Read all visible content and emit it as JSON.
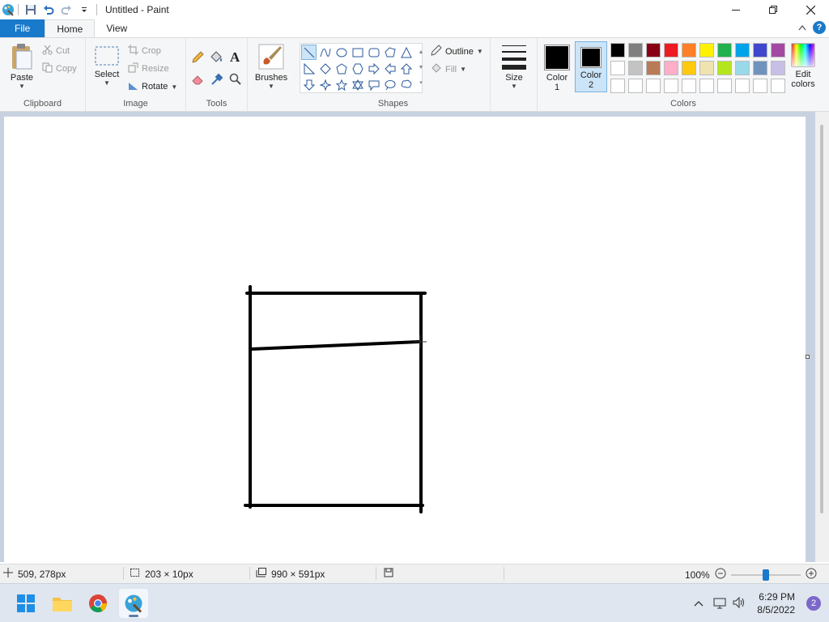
{
  "window": {
    "title": "Untitled - Paint",
    "controls": {
      "minimize": "–",
      "maximize": "❐",
      "close": "✕"
    }
  },
  "tabs": {
    "file": "File",
    "home": "Home",
    "view": "View"
  },
  "ribbon": {
    "clipboard": {
      "label": "Clipboard",
      "paste": "Paste",
      "cut": "Cut",
      "copy": "Copy"
    },
    "image": {
      "label": "Image",
      "select": "Select",
      "crop": "Crop",
      "resize": "Resize",
      "rotate": "Rotate"
    },
    "tools": {
      "label": "Tools"
    },
    "brushes": {
      "label": "Brushes"
    },
    "shapes": {
      "label": "Shapes",
      "outline": "Outline",
      "fill": "Fill"
    },
    "size": {
      "label": "Size"
    },
    "colors": {
      "label": "Colors",
      "color1_line1": "Color",
      "color1_line2": "1",
      "color2_line1": "Color",
      "color2_line2": "2",
      "edit_line1": "Edit",
      "edit_line2": "colors",
      "color1_value": "#000000",
      "color2_value": "#000000",
      "row1": [
        "#000000",
        "#7f7f7f",
        "#880015",
        "#ed1c24",
        "#ff7f27",
        "#fff200",
        "#22b14c",
        "#00a2e8",
        "#3f48cc",
        "#a349a4"
      ],
      "row2": [
        "#ffffff",
        "#c3c3c3",
        "#b97a57",
        "#ffaec9",
        "#ffc90e",
        "#efe4b0",
        "#b5e61d",
        "#99d9ea",
        "#7092be",
        "#c8bfe7"
      ],
      "row3": [
        "#ffffff",
        "#ffffff",
        "#ffffff",
        "#ffffff",
        "#ffffff",
        "#ffffff",
        "#ffffff",
        "#ffffff",
        "#ffffff",
        "#ffffff"
      ]
    }
  },
  "status": {
    "cursor_pos": "509, 278px",
    "selection_size": "203 × 10px",
    "image_size": "990 × 591px",
    "zoom": "100%",
    "zoom_level": 0.5
  },
  "taskbar": {
    "time": "6:29 PM",
    "date": "8/5/2022",
    "notifications": "2"
  }
}
